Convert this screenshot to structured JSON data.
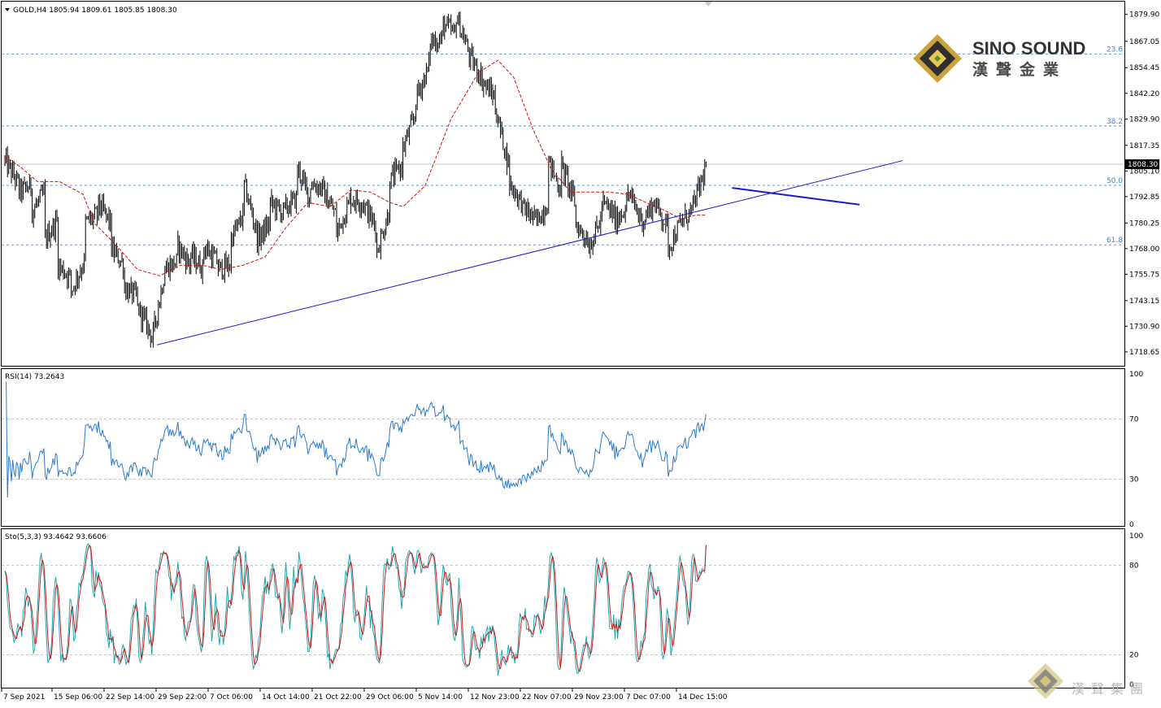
{
  "header": {
    "symbol_info": "GOLD,H4  1805.94 1809.61 1805.85 1808.30",
    "rsi_info": "RSI(14) 73.2643",
    "sto_info": "Sto(5,3,3) 93.4642 93.6606"
  },
  "brand": {
    "name": "SINO SOUND",
    "name_cn": "漢聲金業",
    "footer_cn": "漢聲集團"
  },
  "chart_data": [
    {
      "type": "candlestick",
      "title": "GOLD,H4",
      "ylim": [
        1712,
        1886
      ],
      "ytick_labels": [
        "1879.90",
        "1867.05",
        "1854.45",
        "1842.20",
        "1829.90",
        "1817.35",
        "1805.10",
        "1792.85",
        "1780.25",
        "1768.00",
        "1755.75",
        "1743.15",
        "1730.90",
        "1718.65"
      ],
      "current_price": "1808.30",
      "fib_levels": [
        {
          "label": "23.6",
          "price": 1861.0
        },
        {
          "label": "38.2",
          "price": 1826.6
        },
        {
          "label": "50.0",
          "price": 1798.2
        },
        {
          "label": "61.8",
          "price": 1769.8
        }
      ],
      "price_path": [
        [
          1810,
          1799
        ],
        [
          1795,
          1798
        ],
        [
          1785,
          1795
        ],
        [
          1772,
          1782
        ],
        [
          1760,
          1754
        ],
        [
          1748,
          1762
        ],
        [
          1780,
          1784
        ],
        [
          1790,
          1780
        ],
        [
          1768,
          1760
        ],
        [
          1749,
          1745
        ],
        [
          1740,
          1728
        ],
        [
          1721,
          1755
        ],
        [
          1758,
          1762
        ],
        [
          1770,
          1760
        ],
        [
          1765,
          1758
        ],
        [
          1769,
          1762
        ],
        [
          1758,
          1760
        ],
        [
          1772,
          1784
        ],
        [
          1800,
          1776
        ],
        [
          1772,
          1780
        ],
        [
          1790,
          1785
        ],
        [
          1786,
          1792
        ],
        [
          1808,
          1792
        ],
        [
          1799,
          1797
        ],
        [
          1795,
          1784
        ],
        [
          1775,
          1790
        ],
        [
          1792,
          1790
        ],
        [
          1790,
          1778
        ],
        [
          1765,
          1786
        ],
        [
          1800,
          1808
        ],
        [
          1815,
          1832
        ],
        [
          1840,
          1855
        ],
        [
          1867,
          1868
        ],
        [
          1876,
          1870
        ],
        [
          1880,
          1862
        ],
        [
          1860,
          1850
        ],
        [
          1848,
          1840
        ],
        [
          1835,
          1808
        ],
        [
          1800,
          1790
        ],
        [
          1788,
          1782
        ],
        [
          1780,
          1790
        ],
        [
          1810,
          1795
        ],
        [
          1808,
          1790
        ],
        [
          1780,
          1772
        ],
        [
          1768,
          1782
        ],
        [
          1790,
          1784
        ],
        [
          1780,
          1790
        ],
        [
          1795,
          1782
        ],
        [
          1780,
          1790
        ],
        [
          1790,
          1778
        ],
        [
          1768,
          1780
        ],
        [
          1780,
          1788
        ],
        [
          1790,
          1808.3
        ]
      ],
      "ma_path": [
        [
          0,
          1812
        ],
        [
          12,
          1807
        ],
        [
          24,
          1800
        ],
        [
          40,
          1800
        ],
        [
          58,
          1794
        ],
        [
          66,
          1780
        ],
        [
          82,
          1770
        ],
        [
          98,
          1758
        ],
        [
          114,
          1755
        ],
        [
          130,
          1760
        ],
        [
          146,
          1760
        ],
        [
          160,
          1758
        ],
        [
          176,
          1760
        ],
        [
          192,
          1764
        ],
        [
          208,
          1778
        ],
        [
          224,
          1790
        ],
        [
          240,
          1788
        ],
        [
          256,
          1796
        ],
        [
          270,
          1795
        ],
        [
          284,
          1790
        ],
        [
          294,
          1788
        ],
        [
          310,
          1798
        ],
        [
          330,
          1830
        ],
        [
          350,
          1852
        ],
        [
          364,
          1858
        ],
        [
          376,
          1850
        ],
        [
          390,
          1825
        ],
        [
          404,
          1806
        ],
        [
          418,
          1795
        ],
        [
          432,
          1795
        ],
        [
          446,
          1795
        ],
        [
          460,
          1794
        ],
        [
          474,
          1790
        ],
        [
          488,
          1786
        ],
        [
          500,
          1782
        ],
        [
          510,
          1784
        ],
        [
          518,
          1784
        ]
      ],
      "trendlines": [
        {
          "name": "support",
          "from": [
            0,
            1722
          ],
          "to": [
            560,
            1810
          ]
        },
        {
          "name": "resistance",
          "from": [
            432,
            1797
          ],
          "to": [
            528,
            1789
          ]
        }
      ],
      "x_tick_labels": [
        "7 Sep 2021",
        "15 Sep 06:00",
        "22 Sep 14:00",
        "29 Sep 22:00",
        "7 Oct 06:00",
        "14 Oct 14:00",
        "21 Oct 22:00",
        "29 Oct 06:00",
        "5 Nov 14:00",
        "12 Nov 23:00",
        "22 Nov 07:00",
        "29 Nov 23:00",
        "7 Dec 07:00",
        "14 Dec 15:00"
      ]
    },
    {
      "type": "line",
      "title": "RSI(14)",
      "ylim": [
        0,
        100
      ],
      "ytick_labels": [
        "100",
        "70",
        "30",
        "0"
      ],
      "levels": [
        70,
        30
      ],
      "last_value": 73.2643
    },
    {
      "type": "line",
      "title": "Sto(5,3,3)",
      "ylim": [
        0,
        100
      ],
      "ytick_labels": [
        "100",
        "80",
        "20",
        "0"
      ],
      "levels": [
        80,
        20
      ],
      "main_last": 93.4642,
      "signal_last": 93.6606
    }
  ],
  "colors": {
    "frame": "#000000",
    "candle": "#000000",
    "ma": "#cc1010",
    "trendline": "#1a1acc",
    "grid_level": "#4a84c8",
    "rsi": "#2a7ad0",
    "sto_main": "#20a8b0",
    "sto_signal": "#d01818",
    "current_line": "#b8b8b8"
  }
}
